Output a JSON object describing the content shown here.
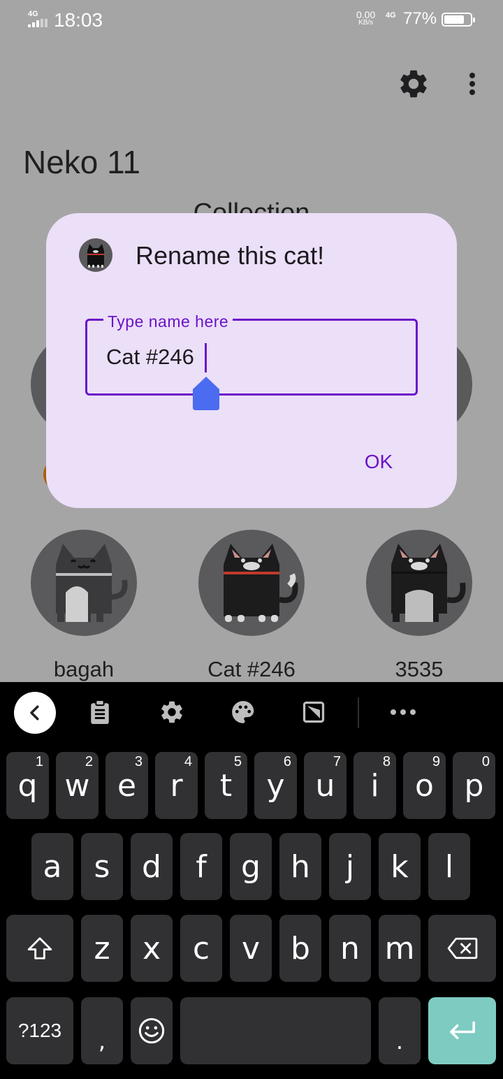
{
  "status_bar": {
    "network": "4G",
    "time": "18:03",
    "data_speed": "0.00",
    "data_speed_unit": "KB/s",
    "network2": "4G",
    "battery_percent": "77%",
    "battery_level": 0.77
  },
  "app": {
    "title": "Neko 11",
    "section_title": "Collection",
    "settings_icon": "gear-icon",
    "overflow_icon": "more-vertical-icon"
  },
  "cats": [
    {
      "name": "bagah"
    },
    {
      "name": "Cat #246"
    },
    {
      "name": "3535"
    }
  ],
  "dialog": {
    "icon": "cat-icon",
    "title": "Rename this cat!",
    "field_label": "Type name here",
    "field_value": "Cat #246",
    "ok_label": "OK"
  },
  "keyboard": {
    "toolbar": [
      "back-icon",
      "clipboard-icon",
      "settings-icon",
      "palette-icon",
      "resize-icon",
      "more-horizontal-icon"
    ],
    "rows": [
      [
        {
          "k": "q",
          "h": "1"
        },
        {
          "k": "w",
          "h": "2"
        },
        {
          "k": "e",
          "h": "3"
        },
        {
          "k": "r",
          "h": "4"
        },
        {
          "k": "t",
          "h": "5"
        },
        {
          "k": "y",
          "h": "6"
        },
        {
          "k": "u",
          "h": "7"
        },
        {
          "k": "i",
          "h": "8"
        },
        {
          "k": "o",
          "h": "9"
        },
        {
          "k": "p",
          "h": "0"
        }
      ],
      [
        {
          "k": "a"
        },
        {
          "k": "s"
        },
        {
          "k": "d"
        },
        {
          "k": "f"
        },
        {
          "k": "g"
        },
        {
          "k": "h"
        },
        {
          "k": "j"
        },
        {
          "k": "k"
        },
        {
          "k": "l"
        }
      ],
      [
        {
          "k": "z"
        },
        {
          "k": "x"
        },
        {
          "k": "c"
        },
        {
          "k": "v"
        },
        {
          "k": "b"
        },
        {
          "k": "n"
        },
        {
          "k": "m"
        }
      ]
    ],
    "symbols_label": "?123",
    "comma": ",",
    "period": ".",
    "accent_color": "#7ecbc2"
  }
}
